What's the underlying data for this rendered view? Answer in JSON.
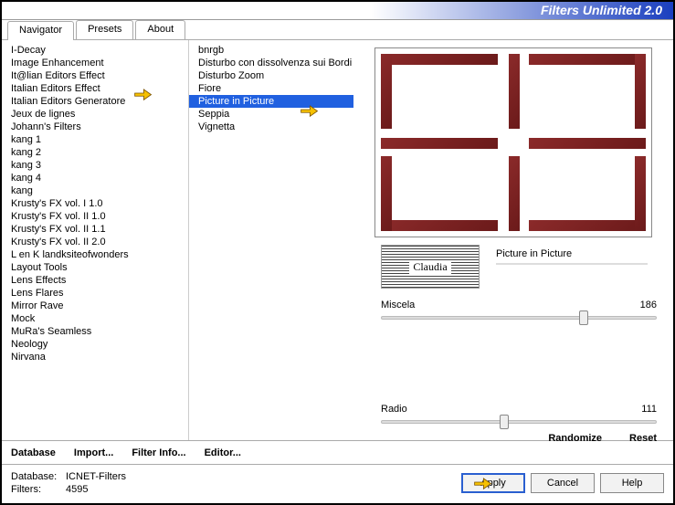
{
  "title": "Filters Unlimited 2.0",
  "tabs": [
    "Navigator",
    "Presets",
    "About"
  ],
  "categories": [
    "I-Decay",
    "Image Enhancement",
    "It@lian Editors Effect",
    "Italian Editors Effect",
    "Italian Editors Generatore",
    "Jeux de lignes",
    "Johann's Filters",
    "kang 1",
    "kang 2",
    "kang 3",
    "kang 4",
    "kang",
    "Krusty's FX vol. I 1.0",
    "Krusty's FX vol. II 1.0",
    "Krusty's FX vol. II 1.1",
    "Krusty's FX vol. II 2.0",
    "L en K landksiteofwonders",
    "Layout Tools",
    "Lens Effects",
    "Lens Flares",
    "Mirror Rave",
    "Mock",
    "MuRa's Seamless",
    "Neology",
    "Nirvana"
  ],
  "categorySelectedIndex": 3,
  "filters": [
    "bnrgb",
    "Disturbo con dissolvenza sui Bordi",
    "Disturbo Zoom",
    "Fiore",
    "Picture in Picture",
    "Seppia",
    "Vignetta"
  ],
  "filterSelectedIndex": 4,
  "currentFilterName": "Picture in Picture",
  "watermark": "Claudia",
  "sliders": {
    "s1": {
      "label": "Miscela",
      "value": "186"
    },
    "s2": {
      "label": "Radio",
      "value": "111"
    }
  },
  "randomize": "Randomize",
  "reset": "Reset",
  "bottom1": {
    "database": "Database",
    "import": "Import...",
    "filterinfo": "Filter Info...",
    "editor": "Editor..."
  },
  "dbinfo": {
    "dbLabel": "Database:",
    "dbName": "ICNET-Filters",
    "filtLabel": "Filters:",
    "filtCount": "4595"
  },
  "buttons": {
    "apply": "Apply",
    "cancel": "Cancel",
    "help": "Help"
  }
}
